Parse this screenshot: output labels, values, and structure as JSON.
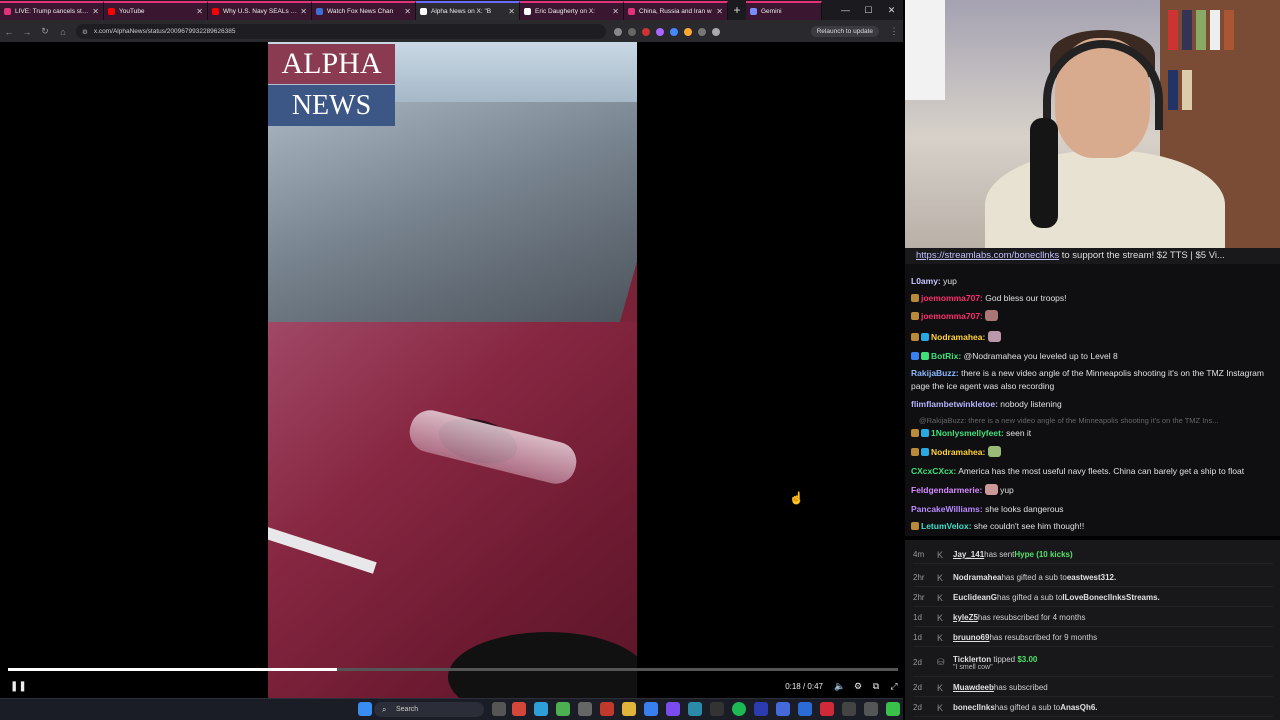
{
  "browser": {
    "tabs": [
      {
        "title": "LIVE: Trump cancels strike",
        "color": "#e0337a"
      },
      {
        "title": "YouTube",
        "color": "#ff0000"
      },
      {
        "title": "Why U.S. Navy SEALs Just",
        "color": "#ff0000"
      },
      {
        "title": "Watch Fox News Chan",
        "color": "#3e6fd8"
      },
      {
        "title": "Alpha News on X: \"B",
        "color": "#ffffff"
      },
      {
        "title": "Eric Daugherty on X:",
        "color": "#ffffff"
      },
      {
        "title": "China, Russia and Iran w",
        "color": "#e0337a"
      },
      {
        "title": "Gemini",
        "color": "#7a8cff"
      }
    ],
    "url": "x.com/AlphaNews/status/2009679932289626385",
    "relaunch_label": "Relaunch to update"
  },
  "video": {
    "logo_line1": "ALPHA",
    "logo_line2": "NEWS",
    "time": "0:18 / 0:47",
    "progress_fraction": 0.37
  },
  "stream": {
    "tip_link": "https://streamlabs.com/bonecllnks",
    "tip_text": " to support the stream! $2 TTS | $5 Vi..."
  },
  "chat": [
    {
      "name": "L0amy:",
      "text": " yup",
      "color": "#c7c7ff",
      "faded": false
    },
    {
      "name": "joemomma707:",
      "text": " God bless our troops!",
      "color": "#ff2e6e",
      "faded": false
    },
    {
      "name": "joemomma707:",
      "text": "",
      "color": "#ff2e6e",
      "faded": false
    },
    {
      "name": "Nodramahea:",
      "text": "",
      "color": "#ffd23b",
      "faded": false
    },
    {
      "name": "BotRix:",
      "text": " @Nodramahea you leveled up to Level 8",
      "color": "#3fe07a",
      "faded": false
    },
    {
      "name": "RakijaBuzz:",
      "text": " there is a new video angle of the Minneapolis shooting it's on the TMZ Instagram page the ice agent was also recording",
      "color": "#8bb8ff",
      "faded": false
    },
    {
      "name": "flimflambetwinkletoe:",
      "text": " nobody listening",
      "color": "#b5b5ff",
      "faded": false
    },
    {
      "name": "",
      "text": "@RakijaBuzz: there is a new video angle of the Minneapolis shooting it's on the TMZ Ins...",
      "color": "#666666",
      "faded": true
    },
    {
      "name": "1Nonlysmellyfeet:",
      "text": " seen it",
      "color": "#3fe07a",
      "faded": false
    },
    {
      "name": "Nodramahea:",
      "text": "",
      "color": "#ffd23b",
      "faded": false
    },
    {
      "name": "CXcxCXcx:",
      "text": " America has the most useful navy fleets. China can barely get a ship to float",
      "color": "#3fe07a",
      "faded": false
    },
    {
      "name": "Feldgendarmerie:",
      "text": " yup",
      "color": "#d78aff",
      "faded": false
    },
    {
      "name": "PancakeWilliams:",
      "text": " she looks dangerous",
      "color": "#b98aff",
      "faded": false
    },
    {
      "name": "LetumVelox:",
      "text": " she couldn't see him though!!",
      "color": "#3fe0c9",
      "faded": false
    }
  ],
  "events": [
    {
      "time": "4m",
      "user": "Jay_141",
      "text": " has sent ",
      "extra": "Hype (10 kicks)"
    },
    {
      "time": "2hr",
      "user": "Nodramahea",
      "text": " has gifted a sub to ",
      "extra": "eastwest312."
    },
    {
      "time": "2hr",
      "user": "EuclideanG",
      "text": " has gifted a sub to ",
      "extra": "ILoveBonecllnksStreams."
    },
    {
      "time": "1d",
      "user": "kyleZ5",
      "text": " has resubscribed for 4 months",
      "extra": ""
    },
    {
      "time": "1d",
      "user": "bruuno69",
      "text": " has resubscribed for 9 months",
      "extra": ""
    },
    {
      "time": "2d",
      "user": "Ticklerton",
      "text": " tipped ",
      "extra": "$3.00",
      "note": "\"I smell cow\""
    },
    {
      "time": "2d",
      "user": "Muawdeeb",
      "text": " has subscribed",
      "extra": ""
    },
    {
      "time": "2d",
      "user": "bonecllnks",
      "text": " has gifted a sub to ",
      "extra": "AnasQh6."
    }
  ],
  "taskbar": {
    "search_placeholder": "Search"
  }
}
